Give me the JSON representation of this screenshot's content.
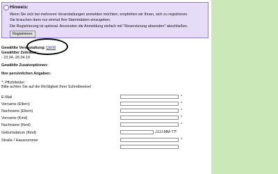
{
  "notice": {
    "title": "Hinweis:",
    "lines": [
      "Wenn Sie sich bei mehreren Veranstaltungen anmelden möchten, empfehlen wir Ihnen, sich zu registrieren.",
      "Sie brauchen dann nur einmal Ihre Stammdaten einzugeben.",
      "Die Registrierung ist optional. Ansonsten die Anmeldung einfach mit \"Reservierung absenden\" abschließen."
    ],
    "register_button": "Registrieren"
  },
  "selection": {
    "event_label": "Gewählte Veranstaltung:",
    "event_value": "QE08",
    "period_label": "Gewählter Zeitraum:",
    "period_value": "- 23.04.-26.04.19",
    "extras_label": "Gewählte Zusatzoptionen:"
  },
  "personal": {
    "heading": "Ihre persönlichen Angaben:",
    "required_note": "*: Pflichtfelder",
    "spelling_note": "Bitte achten Sie auf die Richtigkeit Ihrer Schreibweise!"
  },
  "form": {
    "required_mark": "*",
    "date_hint": "JJJJ-MM-TT",
    "fields": [
      {
        "label": "E-Mail",
        "required": true
      },
      {
        "label": "Vorname (Eltern)",
        "required": true
      },
      {
        "label": "Nachname (Eltern)",
        "required": true
      },
      {
        "label": "Vorname (Kind)",
        "required": true
      },
      {
        "label": "Nachname (Kind)",
        "required": true
      },
      {
        "label": "Geburtsdatum (Kind)",
        "required": true
      },
      {
        "label": "Straße / Hausnummer",
        "required": true
      }
    ]
  },
  "colors": {
    "notice_bg": "#e7dcf8",
    "notice_border": "#8f7cc9",
    "side_bar": "#cbe8b9",
    "link": "#1f3c99"
  }
}
